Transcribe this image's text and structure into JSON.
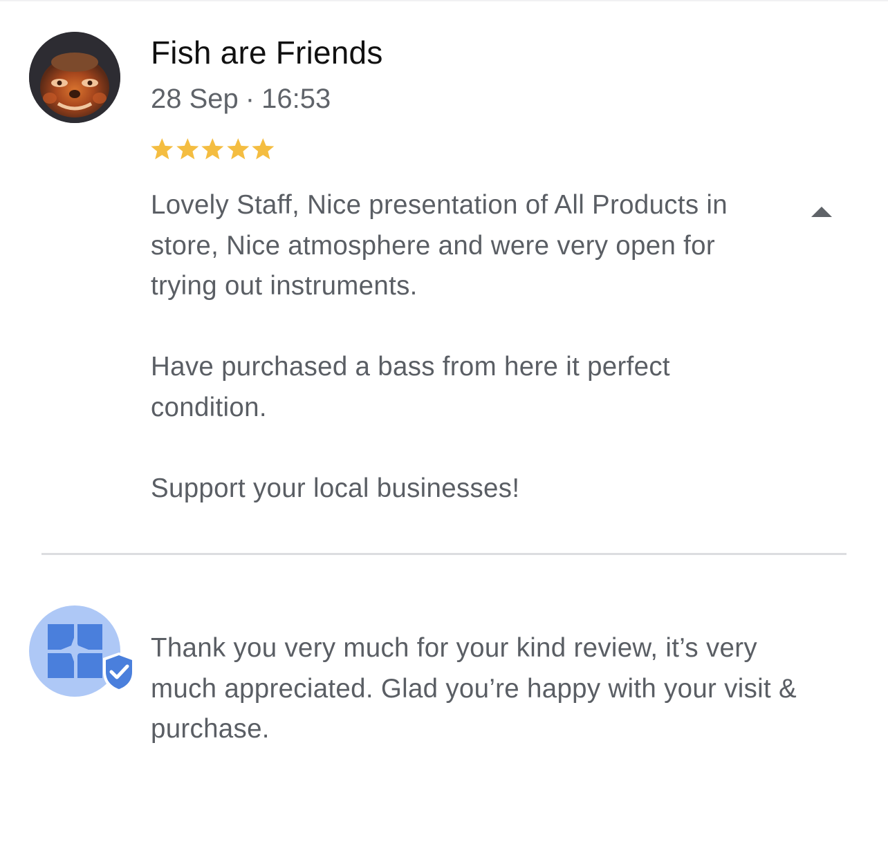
{
  "review": {
    "reviewer_name": "Fish are Friends",
    "date": "28 Sep",
    "separator": "·",
    "time": "16:53",
    "rating": 5,
    "rating_max": 5,
    "star_color": "#f4bd41",
    "paragraphs": [
      "Lovely Staff, Nice presentation of All Products in store, Nice atmosphere and were very open for trying out instruments.",
      "Have purchased a bass from here it perfect condition.",
      "Support your local businesses!"
    ],
    "collapse_icon": "caret-up-icon"
  },
  "owner_response": {
    "avatar_icon": "store-verified-icon",
    "text": "Thank you very much for your kind review, it’s very much appreciated. Glad you’re happy with your visit & purchase."
  }
}
